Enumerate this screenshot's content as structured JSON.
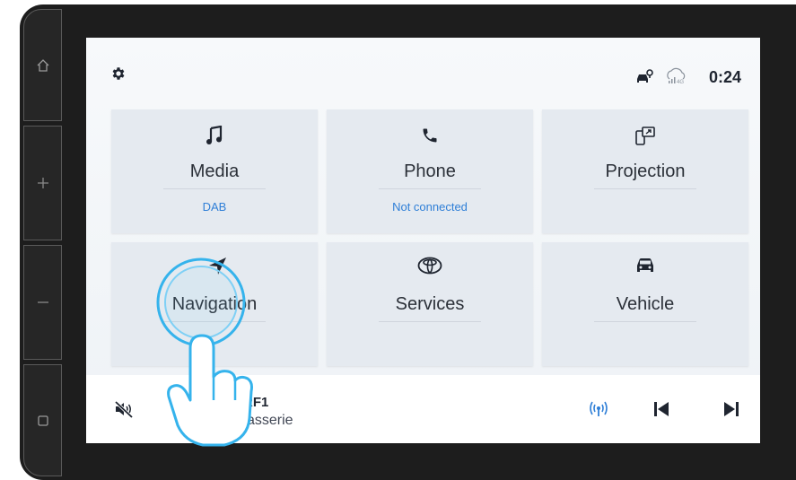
{
  "status": {
    "time": "0:24",
    "network": "4G"
  },
  "tiles": [
    {
      "title": "Media",
      "subtitle": "DAB",
      "icon": "music-note-icon"
    },
    {
      "title": "Phone",
      "subtitle": "Not connected",
      "icon": "phone-icon"
    },
    {
      "title": "Projection",
      "subtitle": "",
      "icon": "projection-icon"
    },
    {
      "title": "Navigation",
      "subtitle": "",
      "icon": "navigation-arrow-icon"
    },
    {
      "title": "Services",
      "subtitle": "",
      "icon": "toyota-logo-icon"
    },
    {
      "title": "Vehicle",
      "subtitle": "",
      "icon": "car-icon"
    }
  ],
  "now_playing": {
    "station": "RF1",
    "program": "Brasserie"
  },
  "colors": {
    "accent": "#2f7fd7",
    "tile": "#e5eaf0",
    "bezel": "#1d1d1d",
    "tap_highlight": "#35b3ec"
  }
}
